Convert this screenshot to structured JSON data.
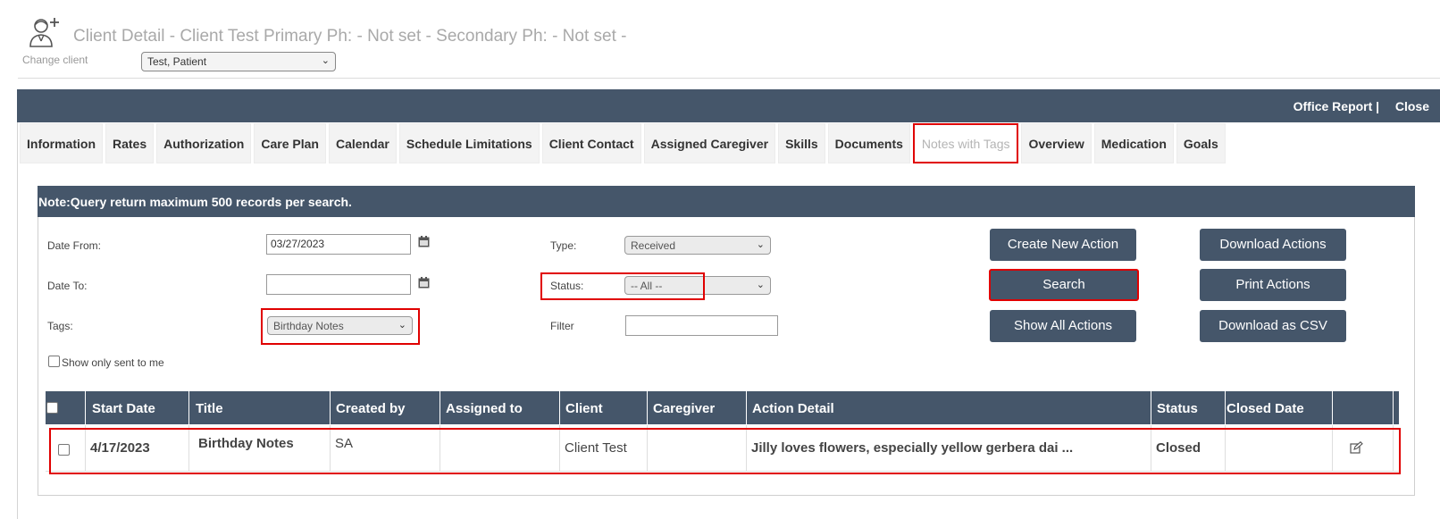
{
  "page_title": "Client Detail - Client Test Primary Ph: - Not set - Secondary Ph: - Not set -",
  "change_client": {
    "label": "Change client",
    "value": "Test, Patient"
  },
  "top_links": {
    "office_report": "Office Report |",
    "close": "Close"
  },
  "tabs": [
    {
      "label": "Information",
      "active": false
    },
    {
      "label": "Rates",
      "active": false
    },
    {
      "label": "Authorization",
      "active": false
    },
    {
      "label": "Care Plan",
      "active": false
    },
    {
      "label": "Calendar",
      "active": false
    },
    {
      "label": "Schedule Limitations",
      "active": false
    },
    {
      "label": "Client Contact",
      "active": false
    },
    {
      "label": "Assigned Caregiver",
      "active": false
    },
    {
      "label": "Skills",
      "active": false
    },
    {
      "label": "Documents",
      "active": false
    },
    {
      "label": "Notes with Tags",
      "active": true
    },
    {
      "label": "Overview",
      "active": false
    },
    {
      "label": "Medication",
      "active": false
    },
    {
      "label": "Goals",
      "active": false
    }
  ],
  "note": "Note:Query return maximum 500 records per search.",
  "filters": {
    "date_from": {
      "label": "Date From:",
      "value": "03/27/2023"
    },
    "date_to": {
      "label": "Date To:",
      "value": ""
    },
    "tags": {
      "label": "Tags:",
      "value": "Birthday Notes"
    },
    "show_only_sent": {
      "label": "Show only sent to me",
      "checked": false
    },
    "type": {
      "label": "Type:",
      "value": "Received"
    },
    "status": {
      "label": "Status:",
      "value": "-- All --"
    },
    "filter": {
      "label": "Filter",
      "value": ""
    }
  },
  "buttons": {
    "create_new_action": "Create New Action",
    "search": "Search",
    "show_all_actions": "Show All Actions",
    "download_actions": "Download Actions",
    "print_actions": "Print Actions",
    "download_csv": "Download as CSV"
  },
  "table": {
    "columns": [
      "Start Date",
      "Title",
      "Created by",
      "Assigned to",
      "Client",
      "Caregiver",
      "Action Detail",
      "Status",
      "Closed Date"
    ],
    "rows": [
      {
        "start_date": "4/17/2023",
        "title": "Birthday Notes",
        "created_by": "SA",
        "assigned_to": "",
        "client": "Client Test",
        "caregiver": "",
        "action_detail": "Jilly loves flowers, especially yellow gerbera dai ...",
        "status": "Closed",
        "closed_date": ""
      }
    ]
  },
  "colors": {
    "header_bar": "#45566a",
    "highlight_red": "#e00000",
    "title_gray": "#a9a9a9"
  },
  "icons": [
    "client-add-icon",
    "calendar-icon",
    "chevron-down-icon",
    "edit-icon"
  ]
}
